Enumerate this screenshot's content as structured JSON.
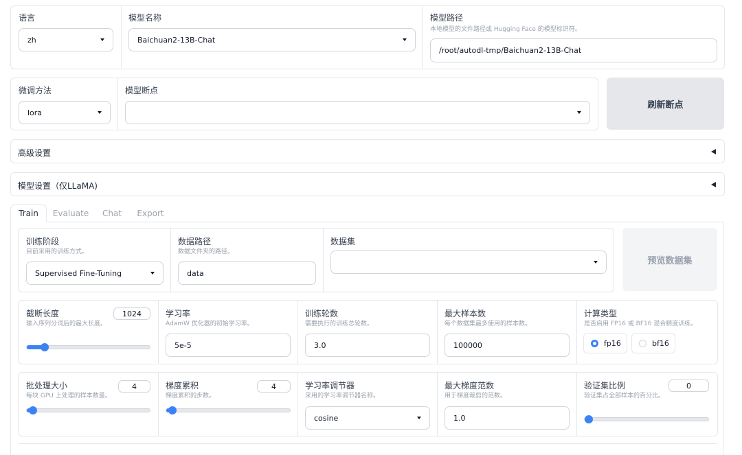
{
  "model_row": {
    "lang": {
      "label": "语言",
      "value": "zh"
    },
    "model_name": {
      "label": "模型名称",
      "value": "Baichuan2-13B-Chat"
    },
    "model_path": {
      "label": "模型路径",
      "description": "本地模型的文件路径或 Hugging Face 的模型标识符。",
      "value": "/root/autodl-tmp/Baichuan2-13B-Chat"
    }
  },
  "finetune_row": {
    "method": {
      "label": "微调方法",
      "value": "lora"
    },
    "checkpoint": {
      "label": "模型断点",
      "value": ""
    },
    "refresh_button": "刷新断点"
  },
  "accordions": {
    "advanced": "高级设置",
    "model_settings": "模型设置（仅LLaMA)"
  },
  "tabs": [
    {
      "label": "Train",
      "active": true
    },
    {
      "label": "Evaluate",
      "active": false
    },
    {
      "label": "Chat",
      "active": false
    },
    {
      "label": "Export",
      "active": false
    }
  ],
  "train": {
    "stage": {
      "label": "训练阶段",
      "description": "目前采用的训练方式。",
      "value": "Supervised Fine-Tuning"
    },
    "dataset_dir": {
      "label": "数据路径",
      "description": "数据文件夹的路径。",
      "value": "data"
    },
    "dataset": {
      "label": "数据集",
      "value": ""
    },
    "preview_button": "预览数据集",
    "cutoff_len": {
      "label": "截断长度",
      "description": "输入序列分词后的最大长度。",
      "value": "1024",
      "fraction": 0.12
    },
    "learning_rate": {
      "label": "学习率",
      "description": "AdamW 优化器的初始学习率。",
      "value": "5e-5"
    },
    "num_epochs": {
      "label": "训练轮数",
      "description": "需要执行的训练总轮数。",
      "value": "3.0"
    },
    "max_samples": {
      "label": "最大样本数",
      "description": "每个数据集最多使用的样本数。",
      "value": "100000"
    },
    "compute_type": {
      "label": "计算类型",
      "description": "是否启用 FP16 或 BF16 混合精度训练。",
      "options": [
        {
          "label": "fp16",
          "selected": true
        },
        {
          "label": "bf16",
          "selected": false
        }
      ]
    },
    "batch_size": {
      "label": "批处理大小",
      "description": "每块 GPU 上处理的样本数量。",
      "value": "4",
      "fraction": 0.02
    },
    "grad_accum": {
      "label": "梯度累积",
      "description": "梯度累积的步数。",
      "value": "4",
      "fraction": 0.02
    },
    "lr_scheduler": {
      "label": "学习率调节器",
      "description": "采用的学习率调节器名称。",
      "value": "cosine"
    },
    "max_grad_norm": {
      "label": "最大梯度范数",
      "description": "用于梯度裁剪的范数。",
      "value": "1.0"
    },
    "val_size": {
      "label": "验证集比例",
      "description": "验证集占全部样本的百分比。",
      "value": "0",
      "fraction": 0.0
    }
  },
  "colors": {
    "accent": "#3b82f6",
    "border": "#e5e7eb",
    "button_bg": "#e5e7eb",
    "button_disabled_bg": "#f3f4f6"
  }
}
